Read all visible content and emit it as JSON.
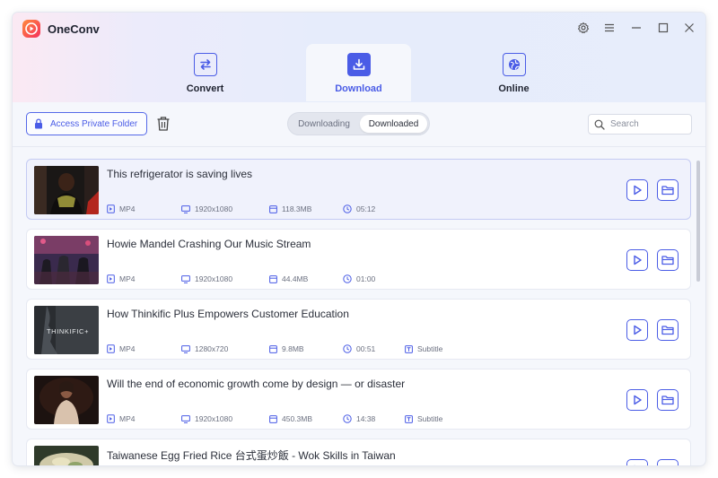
{
  "app": {
    "title": "OneConv"
  },
  "tabs": [
    {
      "label": "Convert",
      "icon": "convert-arrows-icon",
      "active": false
    },
    {
      "label": "Download",
      "icon": "download-icon",
      "active": true
    },
    {
      "label": "Online",
      "icon": "globe-icon",
      "active": false
    }
  ],
  "toolbar": {
    "private_folder_label": "Access Private Folder",
    "segments": [
      {
        "label": "Downloading",
        "selected": false
      },
      {
        "label": "Downloaded",
        "selected": true
      }
    ],
    "search_placeholder": "Search"
  },
  "videos": [
    {
      "title": "This refrigerator is saving lives",
      "format": "MP4",
      "resolution": "1920x1080",
      "size": "118.3MB",
      "duration": "05:12",
      "subtitle": "",
      "selected": true
    },
    {
      "title": "Howie Mandel Crashing Our Music Stream",
      "format": "MP4",
      "resolution": "1920x1080",
      "size": "44.4MB",
      "duration": "01:00",
      "subtitle": "",
      "selected": false
    },
    {
      "title": "How Thinkific Plus Empowers Customer Education",
      "format": "MP4",
      "resolution": "1280x720",
      "size": "9.8MB",
      "duration": "00:51",
      "subtitle": "Subtitle",
      "selected": false,
      "thumb_text": "THINKIFIC+"
    },
    {
      "title": "Will the end of economic growth come by design — or disaster",
      "format": "MP4",
      "resolution": "1920x1080",
      "size": "450.3MB",
      "duration": "14:38",
      "subtitle": "Subtitle",
      "selected": false
    },
    {
      "title": "Taiwanese Egg Fried Rice 台式蛋炒飯 - Wok Skills in Taiwan",
      "format": "",
      "resolution": "",
      "size": "",
      "duration": "",
      "subtitle": "",
      "selected": false
    }
  ],
  "colors": {
    "accent": "#4a5ce6",
    "brand_gradient_start": "#ff8a3d",
    "brand_gradient_end": "#f5305c"
  }
}
